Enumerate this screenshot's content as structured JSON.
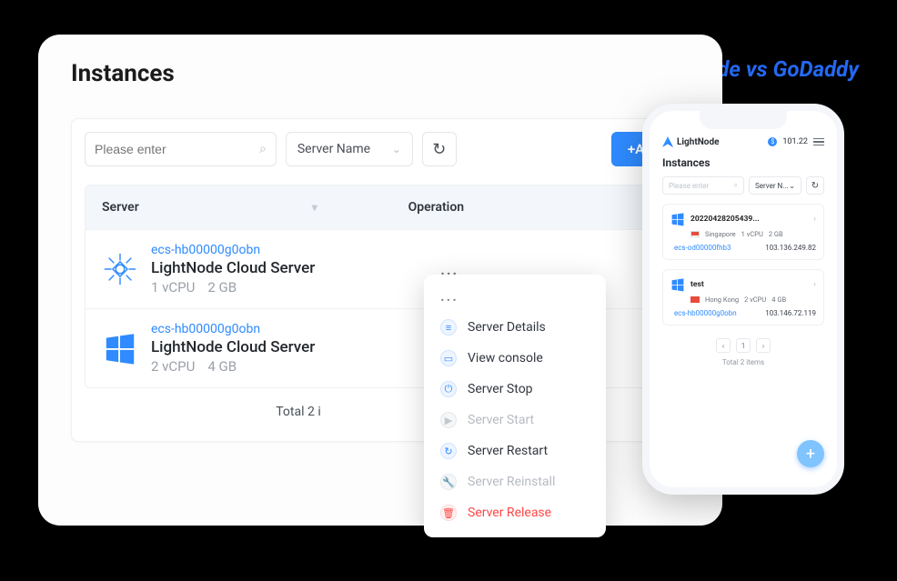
{
  "banner": "LightNode vs GoDaddy",
  "page": {
    "title": "Instances"
  },
  "toolbar": {
    "search_placeholder": "Please enter",
    "filter_label": "Server Name",
    "add_label": "+Add"
  },
  "table": {
    "headers": {
      "server": "Server",
      "operation": "Operation"
    },
    "rows": [
      {
        "os": "centos",
        "id": "ecs-hb00000g0obn",
        "name": "LightNode Cloud Server",
        "cpu": "1 vCPU",
        "mem": "2 GB"
      },
      {
        "os": "windows",
        "id": "ecs-hb00000g0obn",
        "name": "LightNode Cloud Server",
        "cpu": "2 vCPU",
        "mem": "4 GB"
      }
    ],
    "footer": "Total 2 i"
  },
  "menu": {
    "head": "...",
    "items": [
      {
        "icon": "≡",
        "label": "Server Details",
        "state": "normal"
      },
      {
        "icon": "▭",
        "label": "View console",
        "state": "normal"
      },
      {
        "icon": "⏻",
        "label": "Server Stop",
        "state": "normal"
      },
      {
        "icon": "▶",
        "label": "Server Start",
        "state": "disabled"
      },
      {
        "icon": "↻",
        "label": "Server Restart",
        "state": "normal"
      },
      {
        "icon": "🔧",
        "label": "Server Reinstall",
        "state": "disabled"
      },
      {
        "icon": "🗑",
        "label": "Server Release",
        "state": "danger"
      }
    ]
  },
  "phone": {
    "brand": "LightNode",
    "balance": "101.22",
    "title": "Instances",
    "search_placeholder": "Please enter",
    "dropdown": "Server N...",
    "cards": [
      {
        "os": "windows",
        "id": "20220428205439...",
        "flag": "sg",
        "region": "Singapore",
        "cpu": "1 vCPU",
        "mem": "2 GB",
        "ecs": "ecs-od00000fhb3",
        "ip": "103.136.249.82"
      },
      {
        "os": "windows",
        "id": "test",
        "flag": "hk",
        "region": "Hong Kong",
        "cpu": "2 vCPU",
        "mem": "4 GB",
        "ecs": "ecs-hb00000g0obn",
        "ip": "103.146.72.119"
      }
    ],
    "page_current": "1",
    "total": "Total 2 items"
  }
}
